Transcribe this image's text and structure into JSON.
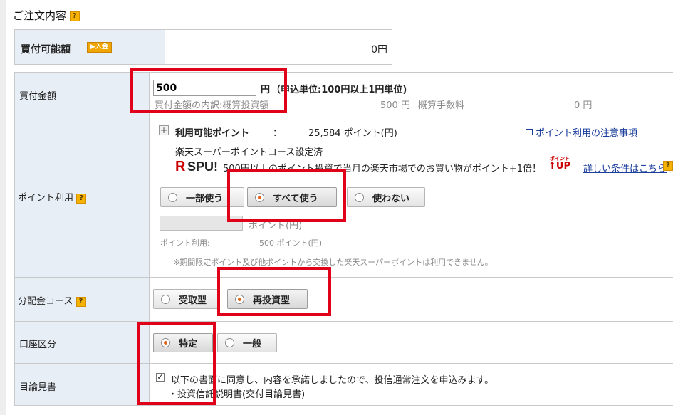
{
  "page": {
    "title": "ご注文内容",
    "help_glyph": "?"
  },
  "buying_power": {
    "label": "買付可能額",
    "deposit_badge": "▶入金",
    "value": "0円"
  },
  "amount": {
    "label": "買付金額",
    "input_value": "500",
    "unit": "円",
    "note": "（申込単位:100円以上1円単位)",
    "breakdown_label": "買付金額の内訳:概算投資額",
    "breakdown_amount": "500 円",
    "fee_label": "概算手数料",
    "fee_value": "0 円"
  },
  "points": {
    "label": "ポイント利用",
    "expand_glyph": "+",
    "available_label": "利用可能ポイント",
    "colon": "：",
    "available_value": "25,584 ポイント(円)",
    "notes_link": "ポイント利用の注意事項",
    "course_set": "楽天スーパーポイントコース設定済",
    "spu_r": "R",
    "spu_text": "SPU!",
    "spu_desc": "500円以上のポイント投資で当月の楽天市場でのお買い物がポイント+1倍！",
    "up_small": "ポイント",
    "up_text": "↑UP",
    "details_link": "詳しい条件はこちら",
    "options": [
      "一部使う",
      "すべて使う",
      "使わない"
    ],
    "selected": "すべて使う",
    "input_unit": "ポイント(円)",
    "usage_label": "ポイント利用:",
    "usage_value": "500 ポイント(円)",
    "disclaimer": "※期間限定ポイント及び他ポイントから交換した楽天スーパーポイントは利用できません。"
  },
  "distribution": {
    "label": "分配金コース",
    "options": [
      "受取型",
      "再投資型"
    ],
    "selected": "再投資型"
  },
  "account": {
    "label": "口座区分",
    "options": [
      "特定",
      "一般"
    ],
    "selected": "特定"
  },
  "prospectus": {
    "label": "目論見書",
    "agree_text": "以下の書面に同意し、内容を承諾しましたので、投信通常注文を申込みます。",
    "doc_text": "・投資信託説明書(交付目論見書)"
  },
  "colors": {
    "highlight_border": "#e0001a",
    "header_bg": "#e8eef5",
    "help_icon": "#f5b200",
    "link": "#1a3d9c",
    "radio_selected": "#e0651a"
  }
}
